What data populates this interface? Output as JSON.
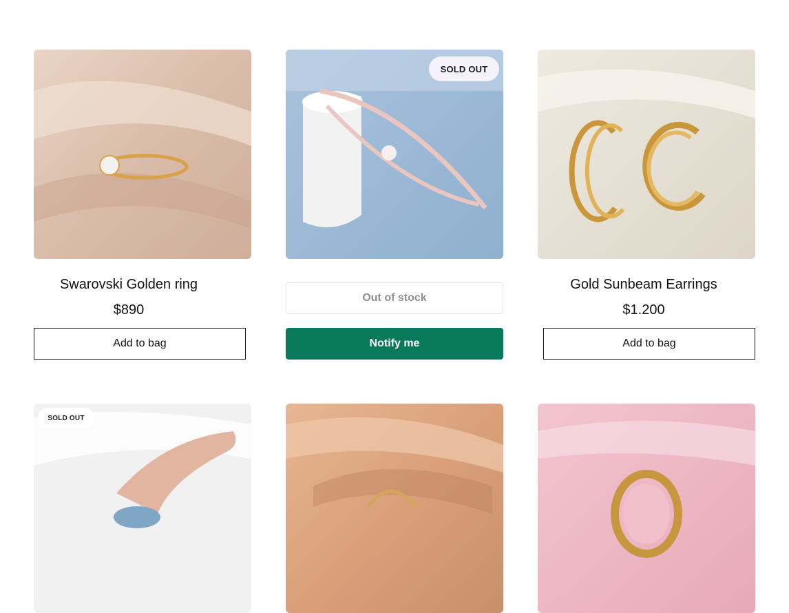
{
  "products": [
    {
      "name": "Swarovski Golden ring",
      "price": "$890",
      "button_label": "Add to bag",
      "image": "gold-solitaire-ring-on-beige-silk"
    },
    {
      "badge": "SOLD OUT",
      "stock_label": "Out of stock",
      "button_label": "Notify me",
      "image": "rose-gold-crystal-bracelet-on-blue",
      "button_color": "#08795a"
    },
    {
      "name": "Gold Sunbeam Earrings",
      "price": "$1.200",
      "button_label": "Add to bag",
      "image": "gold-hoop-earrings-on-cream-silk"
    },
    {
      "badge": "SOLD OUT",
      "image": "hand-with-blue-ring-on-white-knit"
    },
    {
      "image": "gold-earrings-on-peach-satin"
    },
    {
      "image": "ornate-gold-frame-on-pink-satin"
    }
  ]
}
